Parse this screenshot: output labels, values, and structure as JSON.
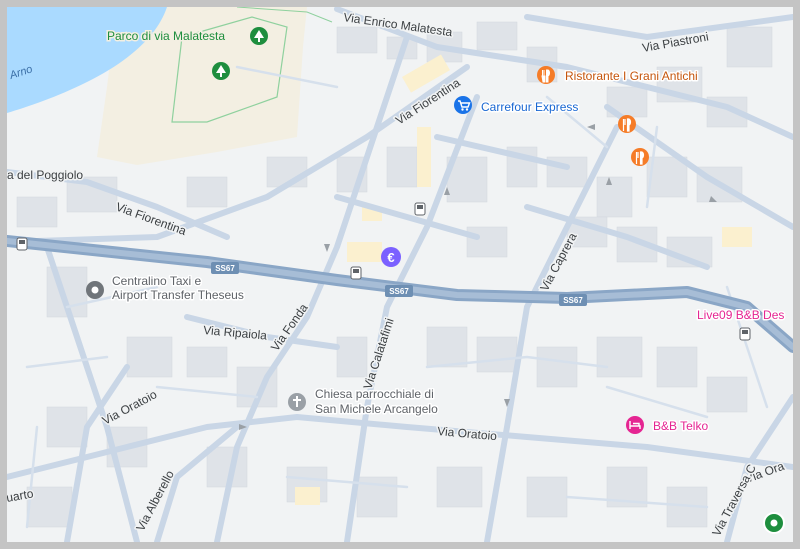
{
  "colors": {
    "water": "#aadaff",
    "park": "#f3efe2",
    "road_main": "#8aa6c6",
    "road_minor": "#c9d6e6",
    "building": "#dfe3e8",
    "poi_food": "#f57c28",
    "poi_shop": "#1a73e8",
    "poi_money": "#7b61ff",
    "poi_hotel": "#e52592",
    "poi_green": "#1e8e3e",
    "poi_gray": "#70757a"
  },
  "water": {
    "label": "Arno"
  },
  "park": {
    "label": "Parco di via Malatesta",
    "icon": "tree-icon"
  },
  "streets": {
    "enrico_malatesta": "Via Enrico Malatesta",
    "piastroni": "Via Piastroni",
    "fiorentina_north": "Via Fiorentina",
    "fiorentina_west": "Via Fiorentina",
    "del_poggiolo": "a del Poggiolo",
    "caprera": "Via Caprera",
    "ripaiola": "Via Ripaiola",
    "fonda": "Via Fonda",
    "calatafimi": "Via Calatafimi",
    "oratoio_west": "Via Oratoio",
    "oratoio_center": "Via Oratoio",
    "oratoio_east": "Via Ora",
    "alberello": "Via Alberello",
    "quarto": "uarto",
    "traversa": "Via Traversa C"
  },
  "road_shields": [
    "SS67",
    "SS67",
    "SS67"
  ],
  "pois": {
    "ristorante": {
      "label": "Ristorante I Grani Antichi",
      "icon": "restaurant-icon"
    },
    "carrefour": {
      "label": "Carrefour Express",
      "icon": "shopping-cart-icon"
    },
    "taxi": {
      "label_line1": "Centralino Taxi e",
      "label_line2": "Airport Transfer Theseus",
      "icon": "place-icon"
    },
    "live09": {
      "label": "Live09 B&B Des",
      "icon": "hotel-icon"
    },
    "chiesa": {
      "label_line1": "Chiesa parrocchiale di",
      "label_line2": "San Michele Arcangelo",
      "icon": "church-icon"
    },
    "bb_telko": {
      "label": "B&B Telko",
      "icon": "bed-icon"
    },
    "euro": {
      "icon": "euro-icon"
    },
    "restaurant_a": {
      "icon": "restaurant-icon"
    },
    "restaurant_b": {
      "icon": "restaurant-icon"
    }
  },
  "transit_stops": [
    "bus-stop-icon",
    "bus-stop-icon",
    "bus-stop-icon",
    "bus-stop-icon"
  ],
  "corner_marker": {
    "icon": "location-dot-icon"
  }
}
